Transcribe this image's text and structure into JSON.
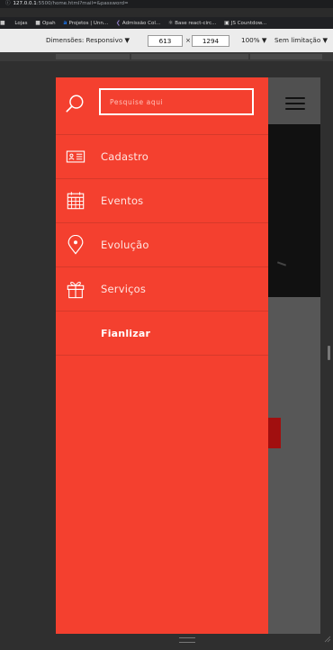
{
  "browser": {
    "url_host": "127.0.0.1",
    "url_rest": ":5500/home.html?mail=&password=",
    "bookmarks": [
      {
        "icon": "folder",
        "label": "Lojas"
      },
      {
        "icon": "folder",
        "label": "Opah"
      },
      {
        "icon": "a",
        "label": "Projetos | Unn..."
      },
      {
        "icon": "kite",
        "label": "Admissão Col..."
      },
      {
        "icon": "react",
        "label": "Base react-circ..."
      },
      {
        "icon": "box",
        "label": "JS Countdow..."
      }
    ],
    "devtools": {
      "dimensions_label": "Dimensões: Responsivo ▼",
      "width": "613",
      "times": "×",
      "height": "1294",
      "zoom": "100% ▼",
      "throttle": "Sem limitação ▼"
    }
  },
  "sidebar": {
    "search_placeholder": "Pesquise aqui",
    "items": [
      {
        "label": "Cadastro",
        "icon": "id-card-icon"
      },
      {
        "label": "Eventos",
        "icon": "calendar-icon"
      },
      {
        "label": "Evolução",
        "icon": "location-pin-icon"
      },
      {
        "label": "Serviços",
        "icon": "gift-icon"
      },
      {
        "label": "Fianlizar",
        "icon": ""
      }
    ]
  },
  "colors": {
    "sidebar_bg": "#f4402f",
    "page_header_bg": "#505050"
  }
}
